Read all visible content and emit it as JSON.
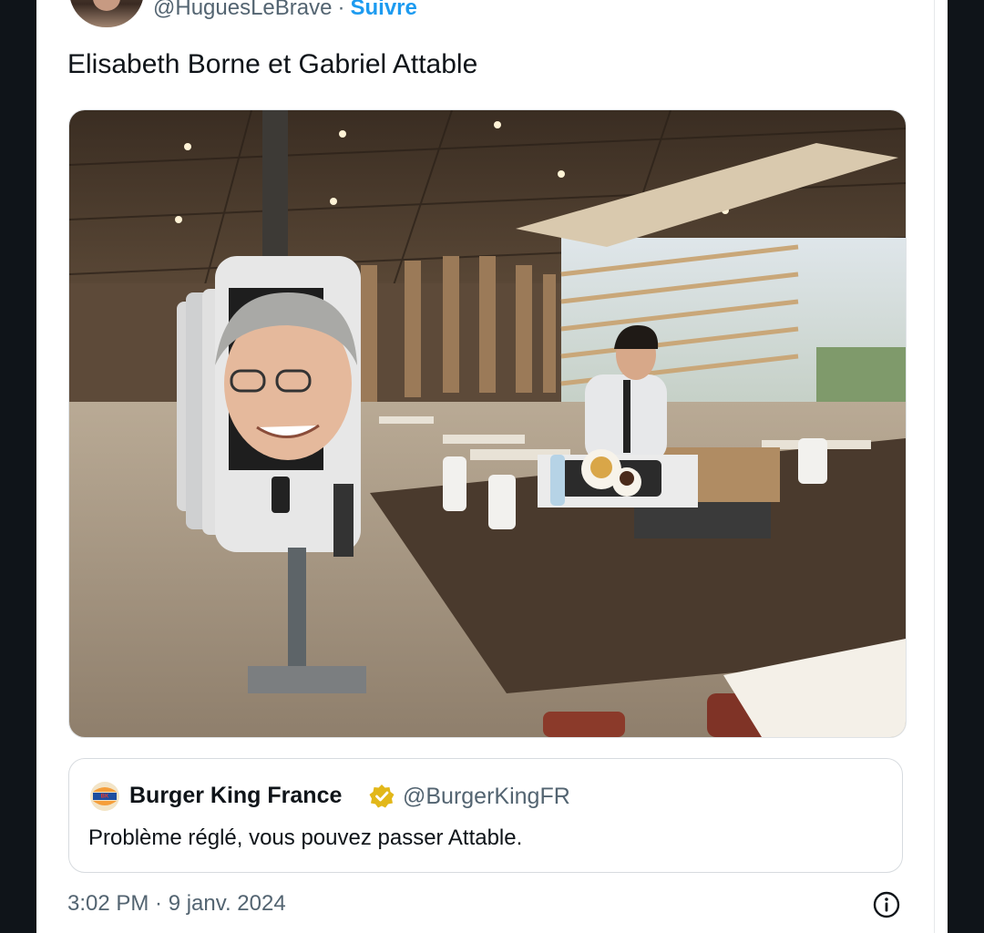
{
  "author": {
    "handle": "@HuguesLeBrave",
    "separator": "·",
    "follow_label": "Suivre"
  },
  "tweet": {
    "text": "Elisabeth Borne et Gabriel Attable"
  },
  "quoted": {
    "name": "Burger King France",
    "handle": "@BurgerKingFR",
    "text": "Problème réglé, vous pouvez passer Attable.",
    "logo_text_top": "BURGER",
    "logo_text_bottom": "KING",
    "verified_color": "#e2b719"
  },
  "meta": {
    "timestamp": "3:02 PM · 9 janv. 2024"
  },
  "colors": {
    "link": "#1d9bf0",
    "secondary_text": "#536471",
    "background_frame": "#0f1419"
  },
  "icons": {
    "info": "info-icon",
    "verified": "verified-badge-icon"
  }
}
